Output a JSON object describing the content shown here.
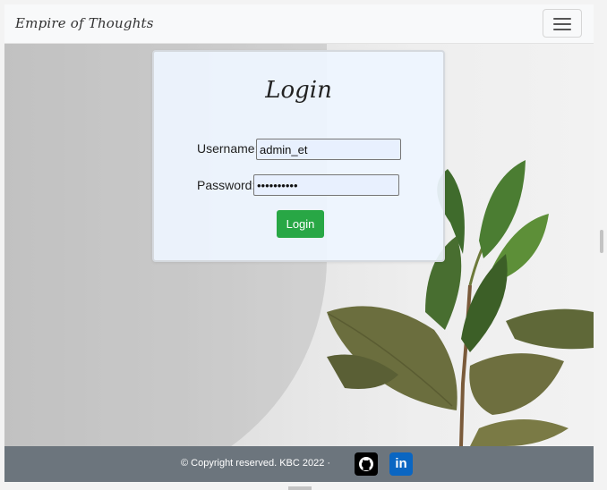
{
  "navbar": {
    "brand": "Empire of Thoughts",
    "toggler_icon": "hamburger-icon"
  },
  "login": {
    "title": "Login",
    "username_label": "Username:",
    "username_value": "admin_et",
    "password_label": "Password:",
    "password_value": "••••••••••",
    "button_label": "Login"
  },
  "footer": {
    "copyright": "© Copyright reserved. KBC 2022 ·",
    "github_icon": "github-icon",
    "linkedin_icon": "linkedin-icon",
    "linkedin_text": "in"
  },
  "colors": {
    "login_button": "#28a745",
    "footer_bg": "#6c757d",
    "linkedin": "#0a66c2",
    "navbar_bg": "#f8f9fa"
  }
}
